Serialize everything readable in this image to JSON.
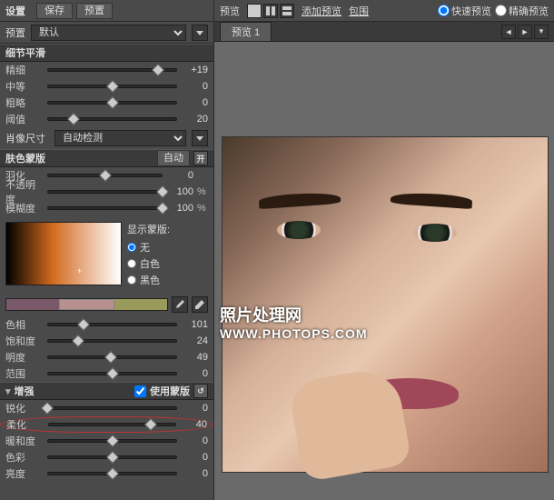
{
  "left": {
    "title": "设置",
    "save_btn": "保存",
    "preset_btn": "预置",
    "preset_label": "预置",
    "preset_value": "默认"
  },
  "sections": {
    "detail": {
      "title": "细节平滑",
      "rows": [
        {
          "label": "精细",
          "value": "+19",
          "pos": 85
        },
        {
          "label": "中等",
          "value": "0",
          "pos": 50
        },
        {
          "label": "粗略",
          "value": "0",
          "pos": 50
        },
        {
          "label": "阈值",
          "value": "20",
          "pos": 20
        }
      ],
      "portrait_size_label": "肖像尺寸",
      "portrait_size_value": "自动检测"
    },
    "mask": {
      "title": "肤色蒙版",
      "auto_btn": "自动",
      "toggle_icon": "开",
      "rows": [
        {
          "label": "羽化",
          "value": "0",
          "pos": 50,
          "unit": ""
        },
        {
          "label": "不透明度",
          "value": "100",
          "pos": 100,
          "unit": "%"
        },
        {
          "label": "模糊度",
          "value": "100",
          "pos": 100,
          "unit": "%"
        }
      ],
      "show_mask_label": "显示蒙版:",
      "radios": [
        "无",
        "白色",
        "黑色"
      ],
      "radio_selected": 0,
      "color_rows": [
        {
          "label": "色相",
          "value": "101",
          "pos": 28
        },
        {
          "label": "饱和度",
          "value": "24",
          "pos": 24
        },
        {
          "label": "明度",
          "value": "49",
          "pos": 49
        },
        {
          "label": "范围",
          "value": "0",
          "pos": 50
        }
      ]
    },
    "enhance": {
      "title": "增强",
      "use_mask_label": "使用蒙版",
      "rows": [
        {
          "label": "锐化",
          "value": "0",
          "pos": 0
        },
        {
          "label": "柔化",
          "value": "40",
          "pos": 80,
          "highlight": true
        },
        {
          "label": "暖和度",
          "value": "0",
          "pos": 50
        },
        {
          "label": "色彩",
          "value": "0",
          "pos": 50
        },
        {
          "label": "亮度",
          "value": "0",
          "pos": 50
        }
      ]
    }
  },
  "right": {
    "preview_label": "预览",
    "add_preview": "添加预览",
    "bracket": "包围",
    "fast_preview": "快速预览",
    "precise_preview": "精确预览",
    "tab_label": "预览 1"
  },
  "watermark": {
    "line1": "照片处理网",
    "line2": "WWW.PHOTOPS.COM"
  }
}
